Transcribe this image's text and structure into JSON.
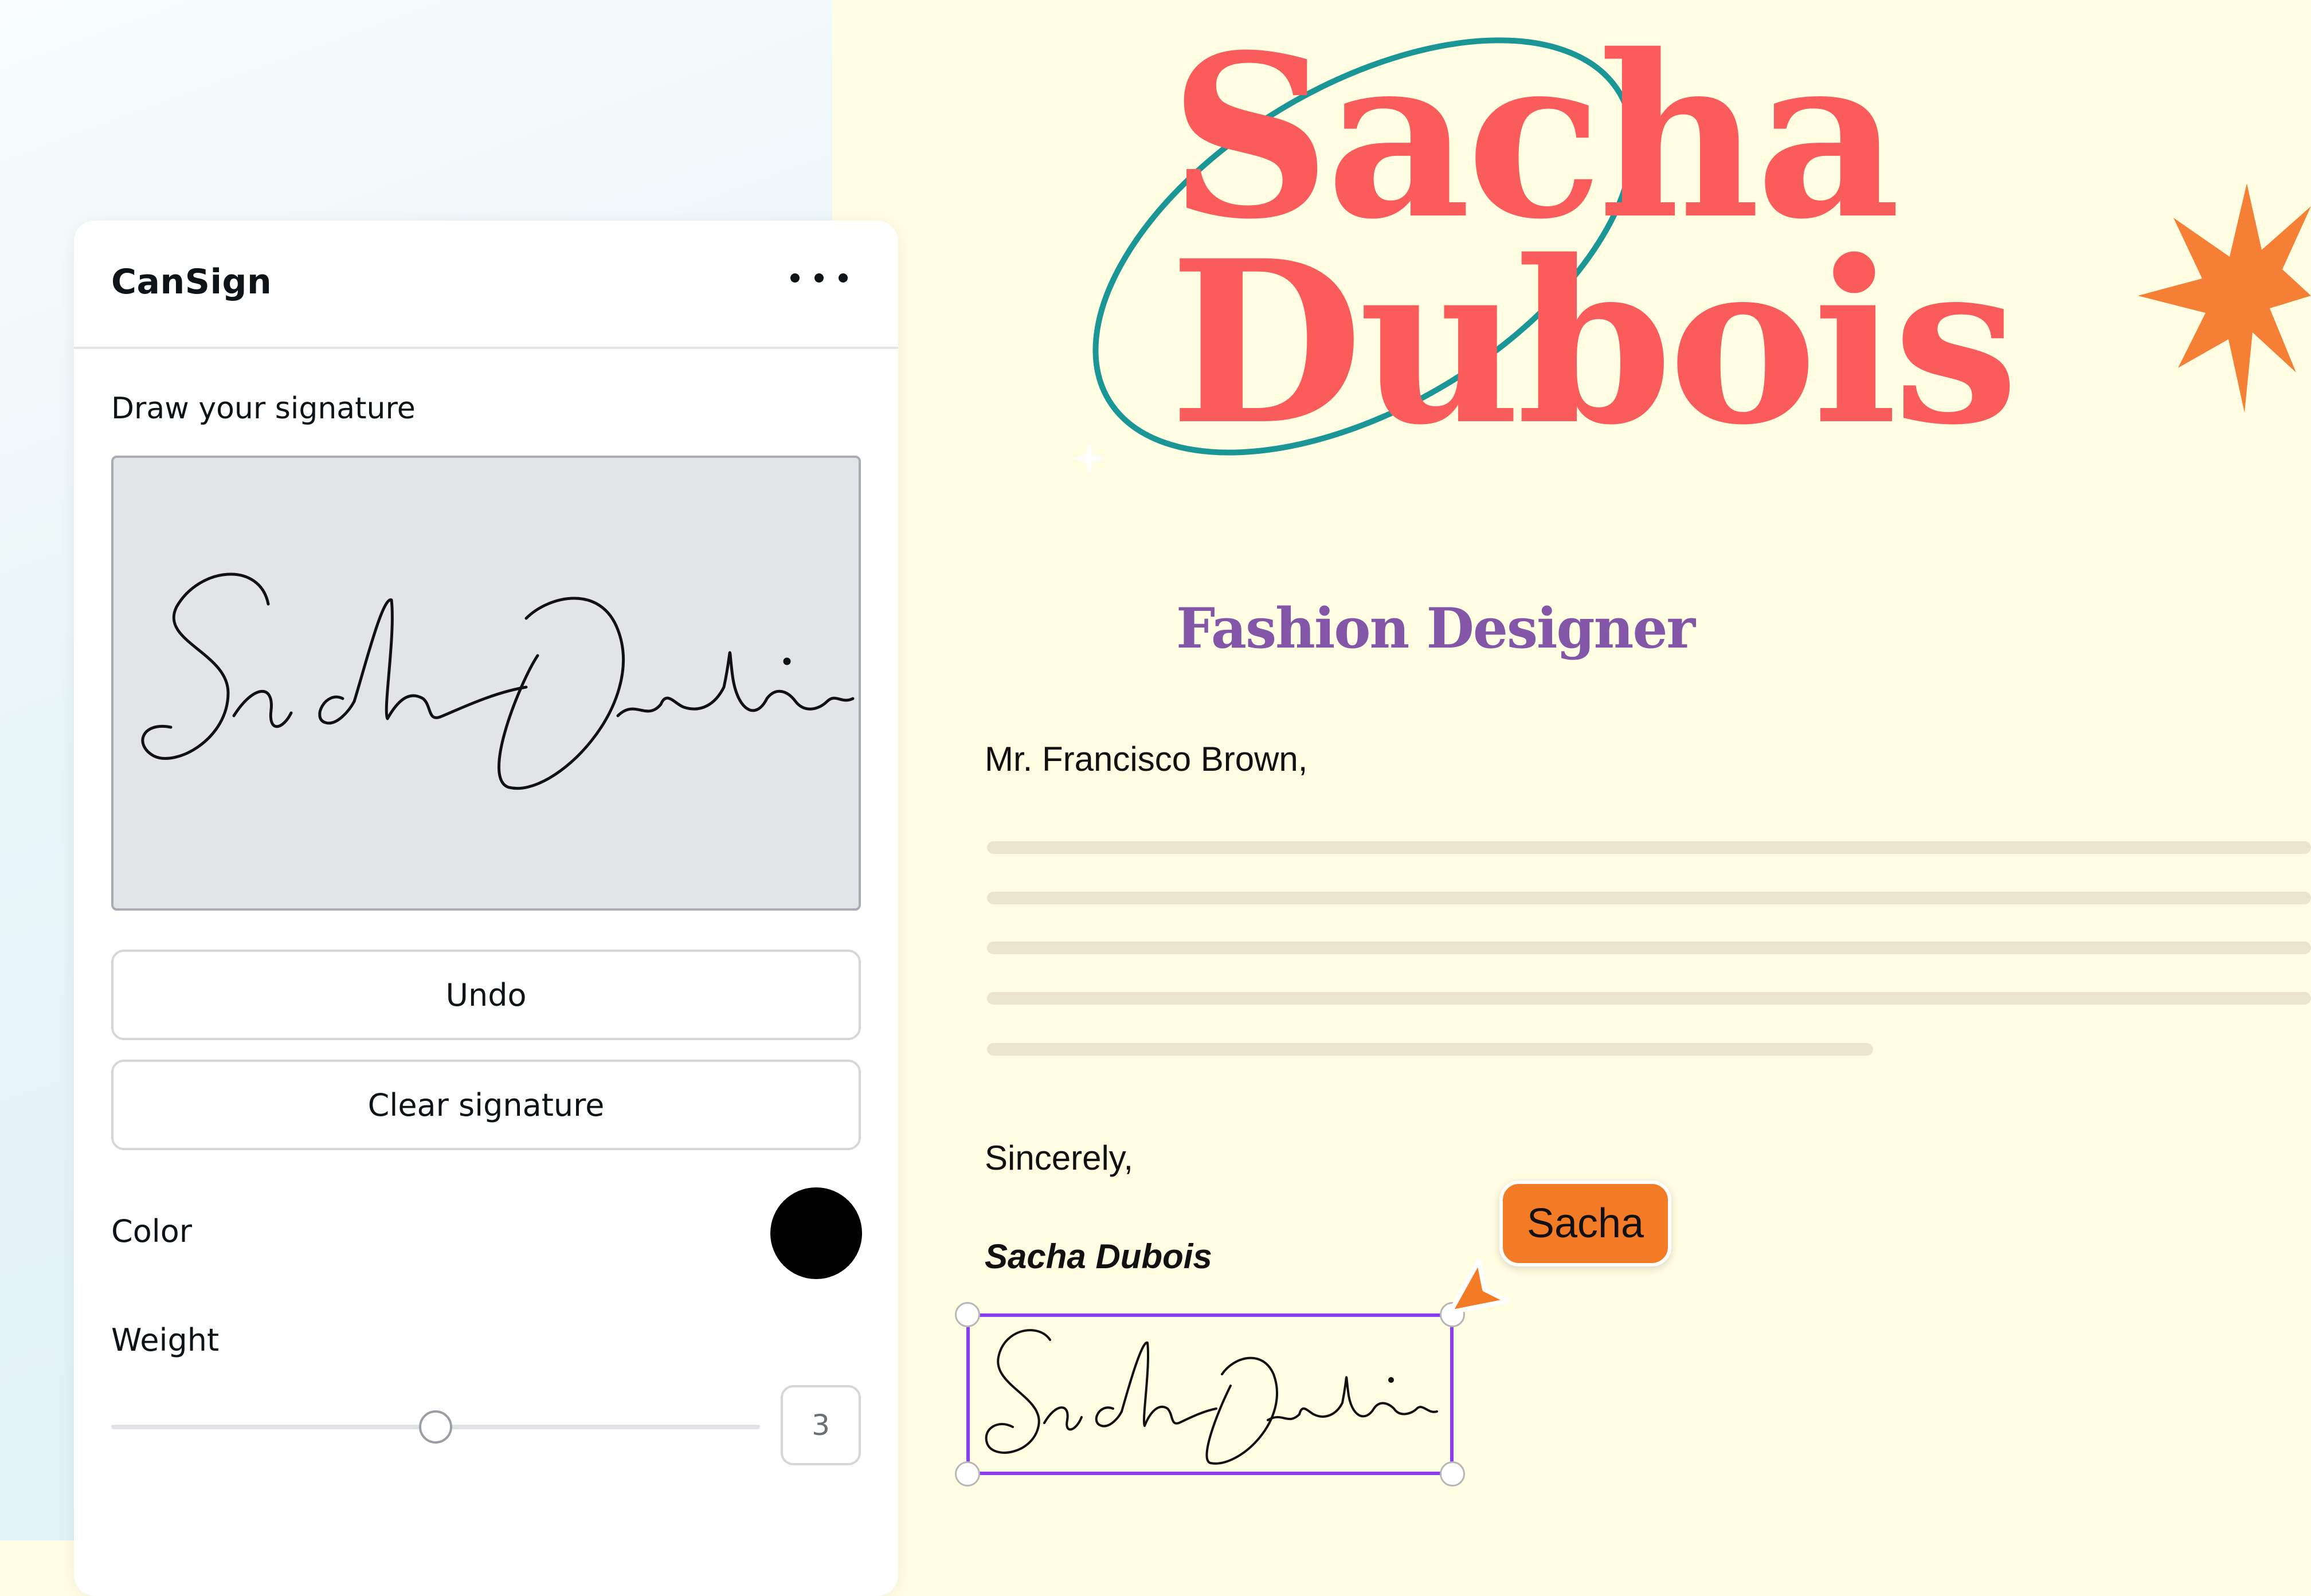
{
  "panel": {
    "title": "CanSign",
    "draw_label": "Draw your signature",
    "undo_label": "Undo",
    "clear_label": "Clear signature",
    "color_label": "Color",
    "color_value": "#000000",
    "weight_label": "Weight",
    "weight_value": "3",
    "weight_fraction": 0.5,
    "menu_icon": "more-horizontal-icon"
  },
  "document": {
    "name_line1": "Sacha",
    "name_line2": "Dubois",
    "subtitle": "Fashion Designer",
    "greeting": "Mr. Francisco Brown,",
    "closing": "Sincerely,",
    "signer_name": "Sacha Dubois",
    "signature_text": "Sacha Dubois",
    "collaborator_tag": "Sacha",
    "colors": {
      "title": "#fa5b5b",
      "subtitle": "#8456a8",
      "ring": "#1a9696",
      "star": "#f47f35",
      "selection": "#8b3df0",
      "collaborator": "#f47b25",
      "page": "#fffde2"
    }
  }
}
